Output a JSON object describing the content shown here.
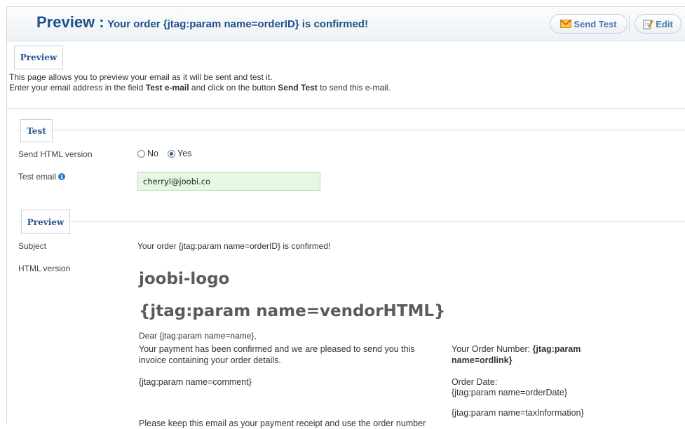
{
  "toolbar": {
    "title_prefix": "Preview :",
    "title_subject": "Your order {jtag:param name=orderID} is confirmed!",
    "send_test_label": "Send Test",
    "edit_label": "Edit"
  },
  "intro": {
    "tab_label": "Preview",
    "line1": "This page allows you to preview your email as it will be sent and test it.",
    "line2_before": "Enter your email address in the field ",
    "line2_field": "Test e-mail",
    "line2_middle": " and click on the button ",
    "line2_button": "Send Test",
    "line2_after": " to send this e-mail."
  },
  "test": {
    "legend": "Test",
    "send_html_label": "Send HTML version",
    "option_no": "No",
    "option_yes": "Yes",
    "selected": "Yes",
    "test_email_label": "Test email",
    "test_email_value": "cherryl@joobi.co"
  },
  "preview": {
    "legend": "Preview",
    "subject_label": "Subject",
    "subject_value": "Your order {jtag:param name=orderID} is confirmed!",
    "html_version_label": "HTML version",
    "email": {
      "logo": "joobi-logo",
      "vendor": "{jtag:param name=vendorHTML}",
      "greeting": "Dear {jtag:param name=name},",
      "paragraph1": "Your payment has been confirmed and we are pleased to send you this invoice containing your order details.",
      "comment": "{jtag:param name=comment}",
      "keep_text": "Please keep this email as your payment receipt and use the order number",
      "order_number_label": "Your Order Number: ",
      "order_number_value": "{jtag:param name=ordlink}",
      "order_date_label": "Order Date:",
      "order_date_value": "{jtag:param name=orderDate}",
      "tax_info": "{jtag:param name=taxInformation}"
    }
  }
}
